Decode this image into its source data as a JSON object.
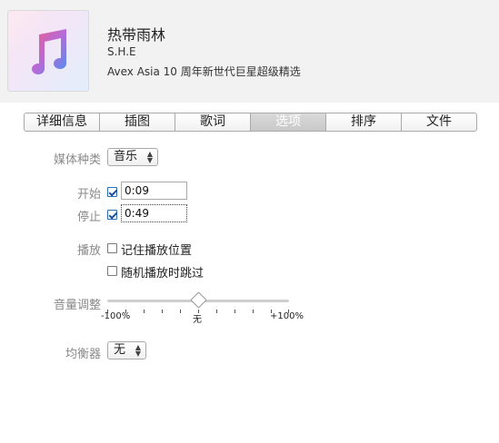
{
  "track": {
    "title": "热带雨林",
    "artist": "S.H.E",
    "album": "Avex Asia 10 周年新世代巨星超级精选"
  },
  "tabs": [
    {
      "label": "详细信息"
    },
    {
      "label": "插图"
    },
    {
      "label": "歌词"
    },
    {
      "label": "选项",
      "active": true
    },
    {
      "label": "排序"
    },
    {
      "label": "文件"
    }
  ],
  "options": {
    "media_kind_label": "媒体种类",
    "media_kind_value": "音乐",
    "start_label": "开始",
    "start_value": "0:09",
    "start_checked": true,
    "stop_label": "停止",
    "stop_value": "0:49",
    "stop_checked": true,
    "playback_label": "播放",
    "remember_position": "记住播放位置",
    "skip_when_shuffling": "随机播放时跳过",
    "volume_label": "音量调整",
    "volume_min": "-100%",
    "volume_mid": "无",
    "volume_max": "+100%",
    "volume_value_percent": 0,
    "equalizer_label": "均衡器",
    "equalizer_value": "无"
  },
  "colors": {
    "header_bg": "#f2f2f2",
    "active_tab": "#c9c9c9",
    "label_gray": "#8a8a8a",
    "checkbox_blue": "#1a4f9c"
  },
  "icons": [
    "music-note-icon",
    "up-down-arrows-icon",
    "checkmark-icon"
  ]
}
